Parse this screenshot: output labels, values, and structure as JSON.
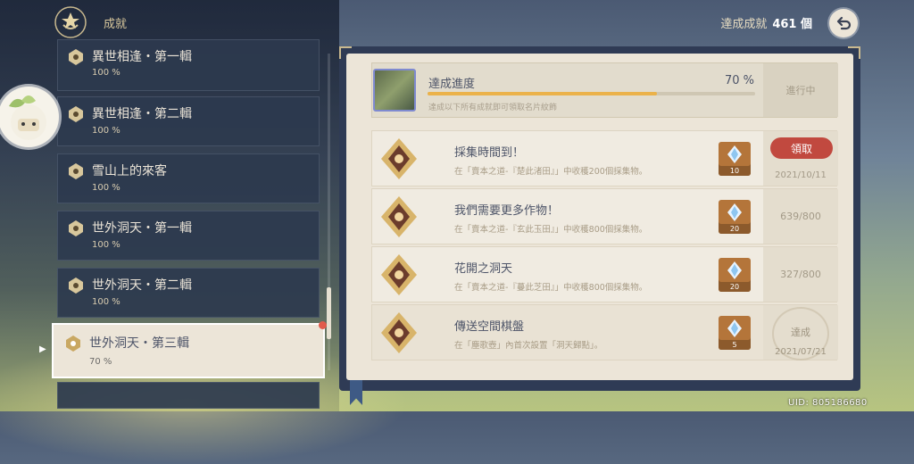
{
  "header": {
    "title": "成就",
    "count_label": "達成成就",
    "count_value": "461 個",
    "icon": "achievement-emblem-icon",
    "back_icon": "back-arrow-icon"
  },
  "categories": [
    {
      "name": "異世相逢・第一輯",
      "percent": "100 %"
    },
    {
      "name": "異世相逢・第二輯",
      "percent": "100 %"
    },
    {
      "name": "雪山上的來客",
      "percent": "100 %"
    },
    {
      "name": "世外洞天・第一輯",
      "percent": "100 %"
    },
    {
      "name": "世外洞天・第二輯",
      "percent": "100 %"
    },
    {
      "name": "世外洞天・第三輯",
      "percent": "70 %"
    }
  ],
  "progress": {
    "title": "達成進度",
    "percent": "70 %",
    "fill": 0.7,
    "subtitle": "達成以下所有成就即可領取名片紋飾",
    "status": "進行中"
  },
  "achievements": [
    {
      "title": "採集時間到！",
      "desc": "在「賣本之道-『楚此渚田』」中收穫200個採集物。",
      "reward": "10",
      "claim_label": "領取",
      "date": "2021/10/11"
    },
    {
      "title": "我們需要更多作物！",
      "desc": "在「賣本之道-『玄此玉田』」中收穫800個採集物。",
      "reward": "20",
      "progress": "639/800"
    },
    {
      "title": "花開之洞天",
      "desc": "在「賣本之道-『蔓此芝田』」中收穫800個採集物。",
      "reward": "20",
      "progress": "327/800"
    },
    {
      "title": "傳送空間棋盤",
      "desc": "在「塵歌壺」內首次設置「洞天歸點」。",
      "reward": "5",
      "done_label": "達成",
      "date": "2021/07/21"
    }
  ],
  "uid": "UID: 805186680",
  "colors": {
    "accent": "#ebb24a",
    "claim": "#c1493f",
    "panel": "#ece5d8",
    "list_bg": "#2d394e"
  }
}
